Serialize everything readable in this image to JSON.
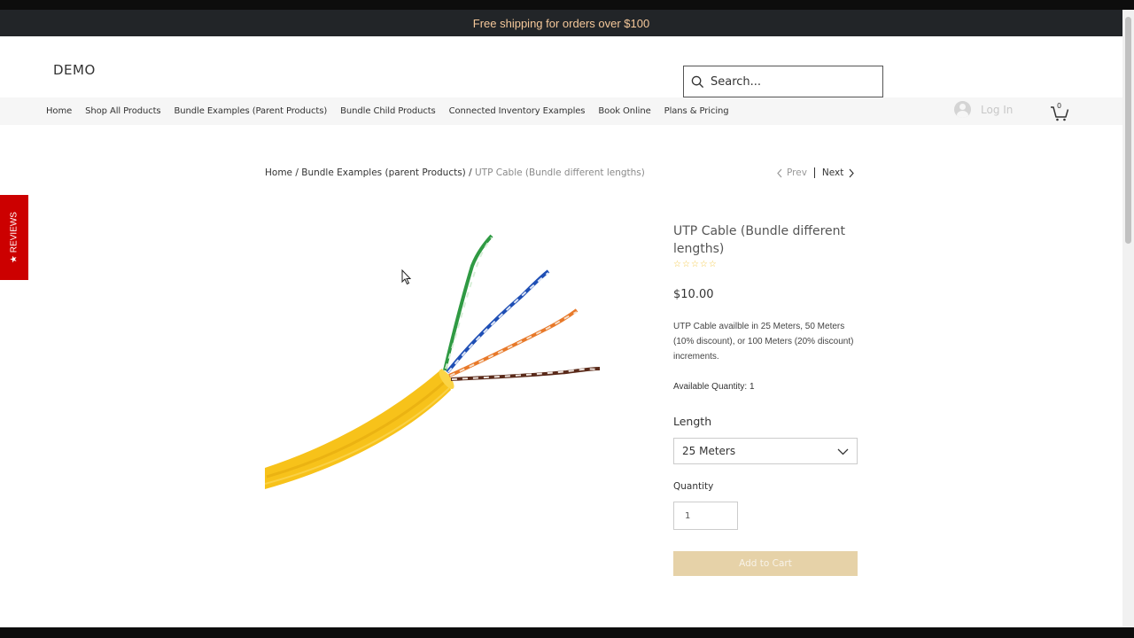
{
  "promo": {
    "text": "Free shipping for orders over $100"
  },
  "header": {
    "logo": "DEMO",
    "search_placeholder": "Search...",
    "login_label": "Log In",
    "cart_count": "0"
  },
  "nav": {
    "items": [
      "Home",
      "Shop All Products",
      "Bundle Examples (Parent Products)",
      "Bundle Child Products",
      "Connected Inventory Examples",
      "Book Online",
      "Plans & Pricing"
    ]
  },
  "breadcrumb": {
    "home": "Home",
    "sep1": " / ",
    "parent": "Bundle Examples (parent Products)",
    "sep2": " / ",
    "current": "UTP Cable (Bundle different lengths)"
  },
  "pager": {
    "prev": "Prev",
    "next": "Next"
  },
  "product": {
    "title": "UTP Cable (Bundle different lengths)",
    "rating_stars": 5,
    "price": "$10.00",
    "description": "UTP Cable availble in 25 Meters, 50 Meters (10% discount), or 100 Meters (20% discount) increments.",
    "available": "Available Quantity: 1",
    "length_label": "Length",
    "length_selected": "25 Meters",
    "quantity_label": "Quantity",
    "quantity_value": "1",
    "add_to_cart": "Add to Cart"
  },
  "reviews_tab": {
    "label": "★ REVIEWS"
  },
  "colors": {
    "promo_bg": "#222528",
    "promo_text": "#f5c89a",
    "accent_button": "#e6d2a8",
    "reviews_red": "#cc0000",
    "star": "#f4c94a",
    "cable_yellow": "#f7c21a"
  },
  "icons": [
    "search-icon",
    "user-avatar-icon",
    "cart-icon",
    "chevron-left-icon",
    "chevron-right-icon",
    "chevron-down-icon",
    "star-icon"
  ]
}
